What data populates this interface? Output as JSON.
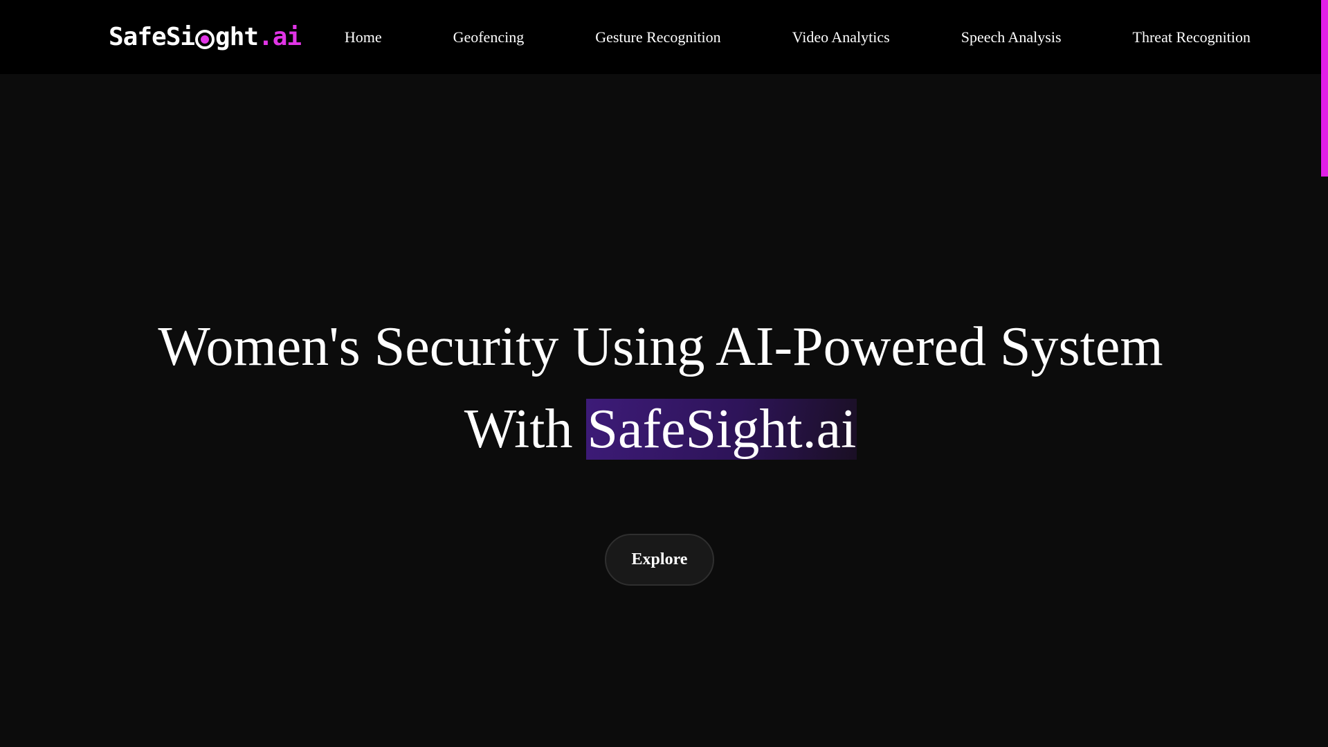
{
  "nav": {
    "logo": {
      "part1": "SafeSi",
      "part2": "ght",
      "part3": ".ai"
    },
    "links": [
      {
        "label": "Home"
      },
      {
        "label": "Geofencing"
      },
      {
        "label": "Gesture Recognition"
      },
      {
        "label": "Video Analytics"
      },
      {
        "label": "Speech Analysis"
      },
      {
        "label": "Threat Recognition"
      }
    ]
  },
  "hero": {
    "title_line1": "Women's Security Using AI-Powered System",
    "title_line2_prefix": "With ",
    "title_highlight": "SafeSight.ai",
    "explore_label": "Explore"
  },
  "colors": {
    "accent": "#e135e6",
    "highlight_bg": "#3d1b78",
    "navbar_bg": "#000000",
    "page_bg": "#0c0c0c"
  }
}
